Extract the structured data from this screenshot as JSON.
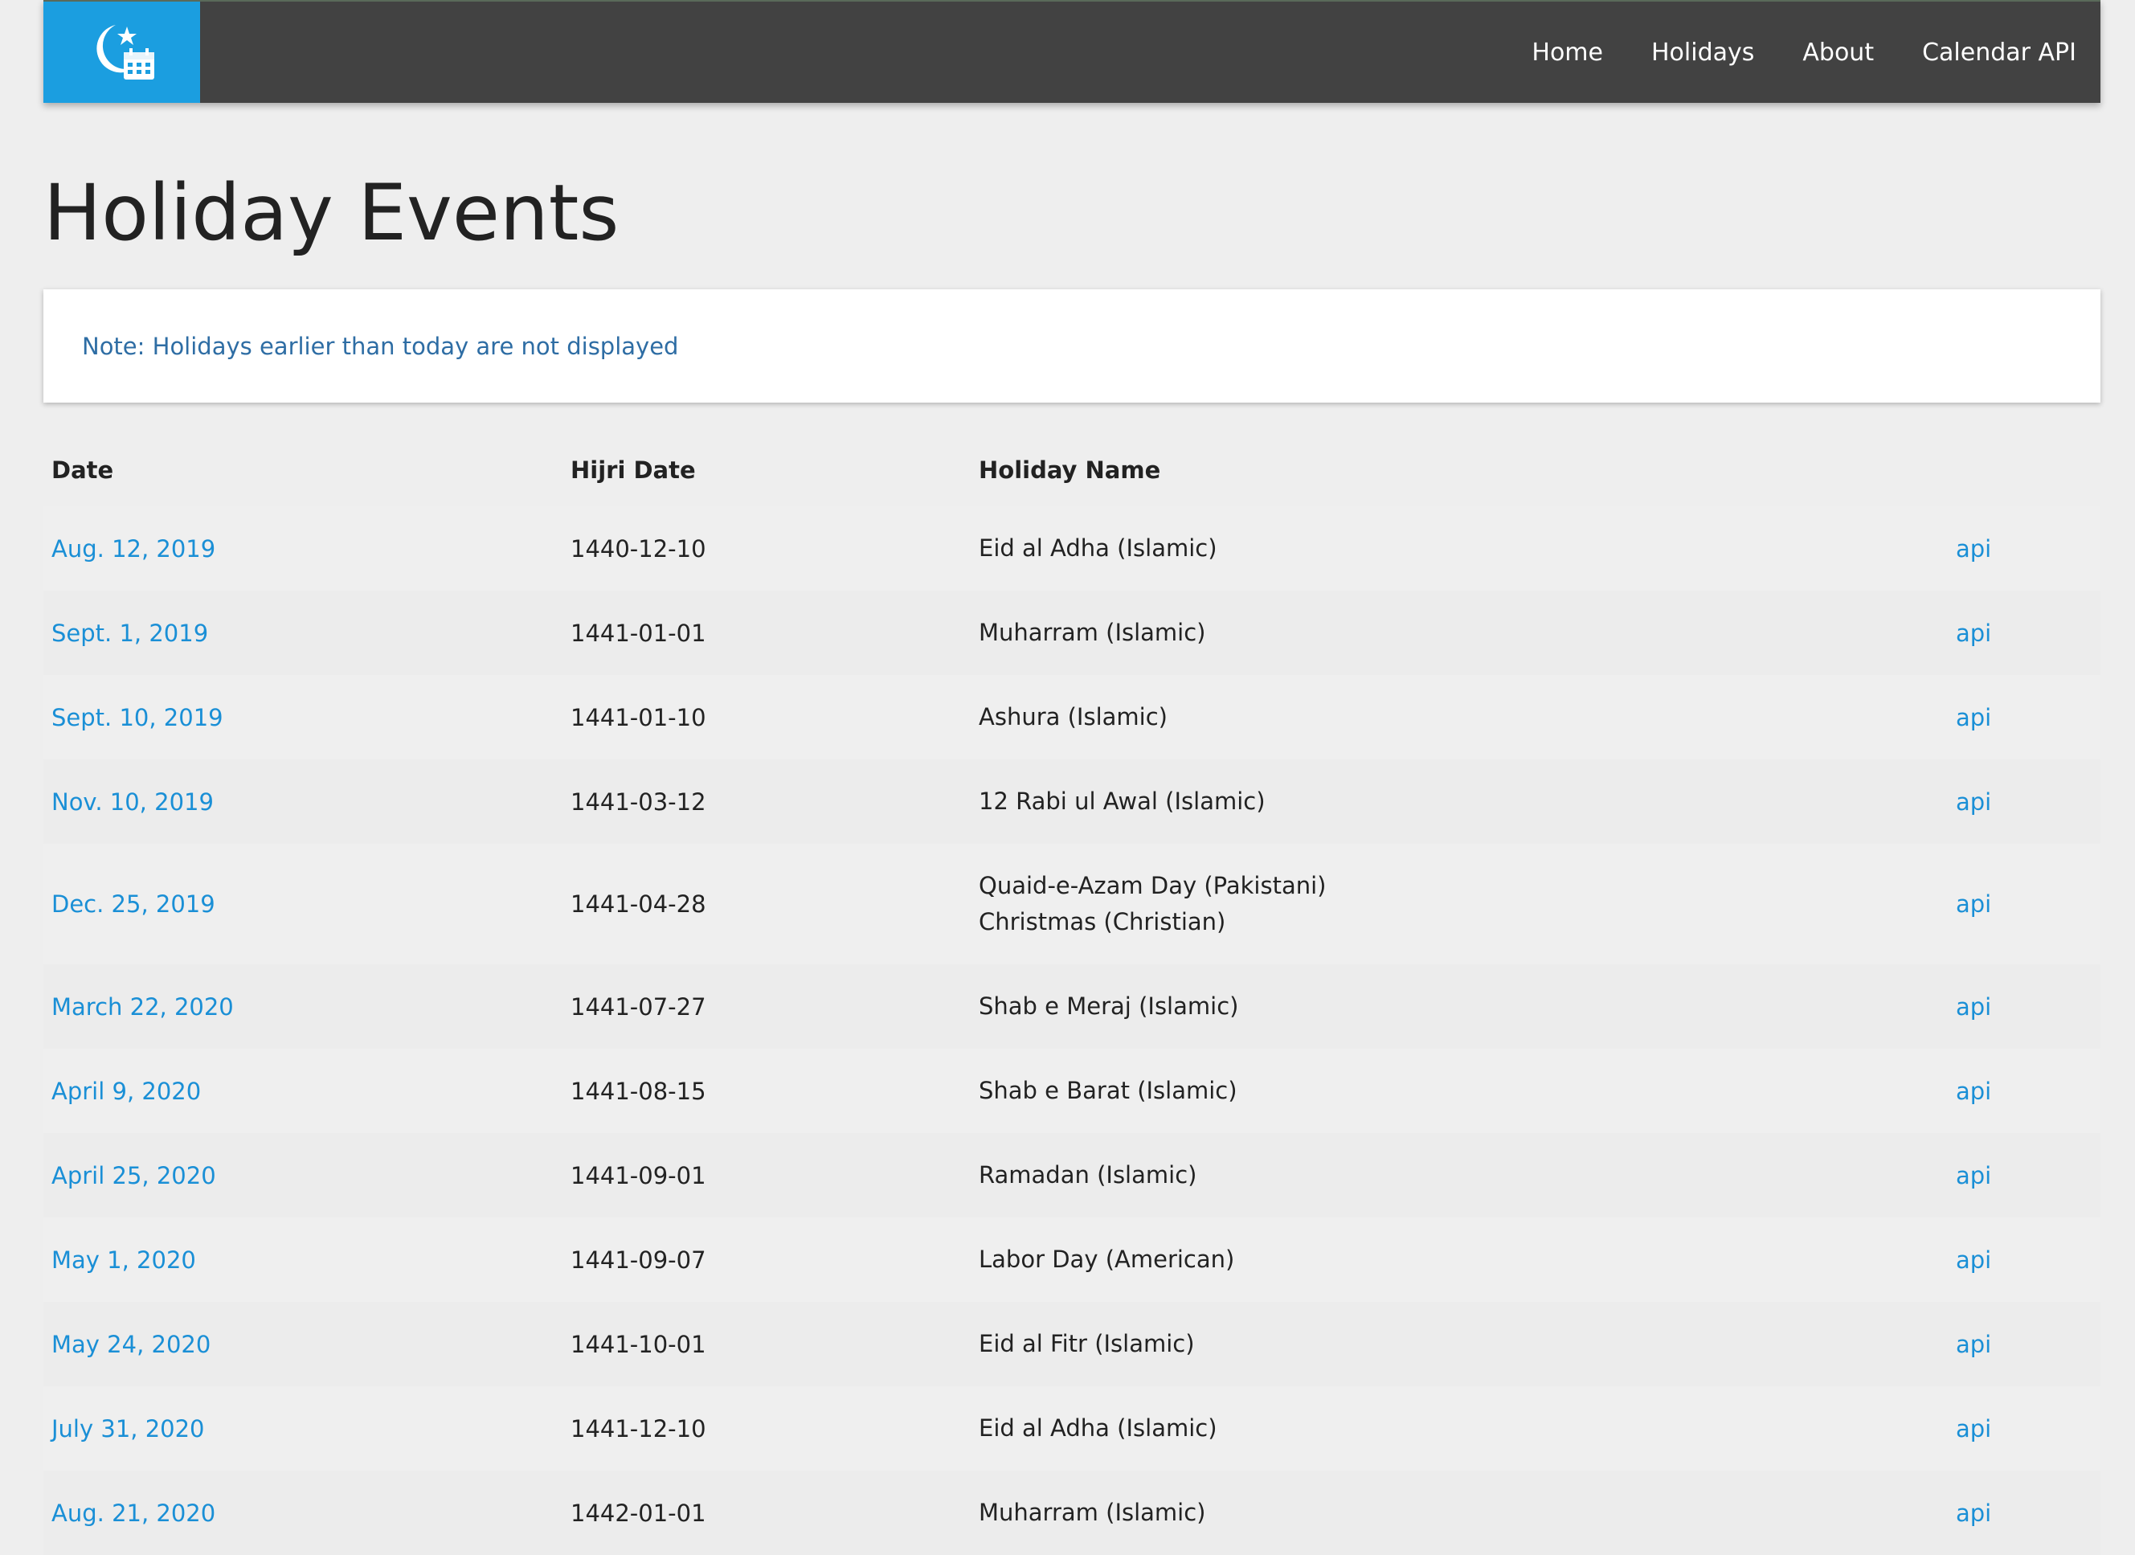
{
  "nav": {
    "logo_icon": "crescent-star-calendar-icon",
    "logo_color": "#1b9ee0",
    "bar_color": "#424242",
    "links": [
      "Home",
      "Holidays",
      "About",
      "Calendar API"
    ]
  },
  "page": {
    "title": "Holiday Events",
    "note": "Note: Holidays earlier than today are not displayed"
  },
  "table": {
    "headers": {
      "date": "Date",
      "hijri": "Hijri Date",
      "name": "Holiday Name"
    },
    "link_color": "#1a8fd6",
    "rows": [
      {
        "date": "Aug. 12, 2019",
        "hijri": "1440-12-10",
        "names": [
          "Eid al Adha (Islamic)"
        ],
        "api": "api"
      },
      {
        "date": "Sept. 1, 2019",
        "hijri": "1441-01-01",
        "names": [
          "Muharram (Islamic)"
        ],
        "api": "api"
      },
      {
        "date": "Sept. 10, 2019",
        "hijri": "1441-01-10",
        "names": [
          "Ashura (Islamic)"
        ],
        "api": "api"
      },
      {
        "date": "Nov. 10, 2019",
        "hijri": "1441-03-12",
        "names": [
          "12 Rabi ul Awal (Islamic)"
        ],
        "api": "api"
      },
      {
        "date": "Dec. 25, 2019",
        "hijri": "1441-04-28",
        "names": [
          "Quaid-e-Azam Day (Pakistani)",
          "Christmas (Christian)"
        ],
        "api": "api"
      },
      {
        "date": "March 22, 2020",
        "hijri": "1441-07-27",
        "names": [
          "Shab e Meraj (Islamic)"
        ],
        "api": "api"
      },
      {
        "date": "April 9, 2020",
        "hijri": "1441-08-15",
        "names": [
          "Shab e Barat (Islamic)"
        ],
        "api": "api"
      },
      {
        "date": "April 25, 2020",
        "hijri": "1441-09-01",
        "names": [
          "Ramadan (Islamic)"
        ],
        "api": "api"
      },
      {
        "date": "May 1, 2020",
        "hijri": "1441-09-07",
        "names": [
          "Labor Day (American)"
        ],
        "api": "api"
      },
      {
        "date": "May 24, 2020",
        "hijri": "1441-10-01",
        "names": [
          "Eid al Fitr (Islamic)"
        ],
        "api": "api"
      },
      {
        "date": "July 31, 2020",
        "hijri": "1441-12-10",
        "names": [
          "Eid al Adha (Islamic)"
        ],
        "api": "api"
      },
      {
        "date": "Aug. 21, 2020",
        "hijri": "1442-01-01",
        "names": [
          "Muharram (Islamic)"
        ],
        "api": "api"
      }
    ]
  }
}
